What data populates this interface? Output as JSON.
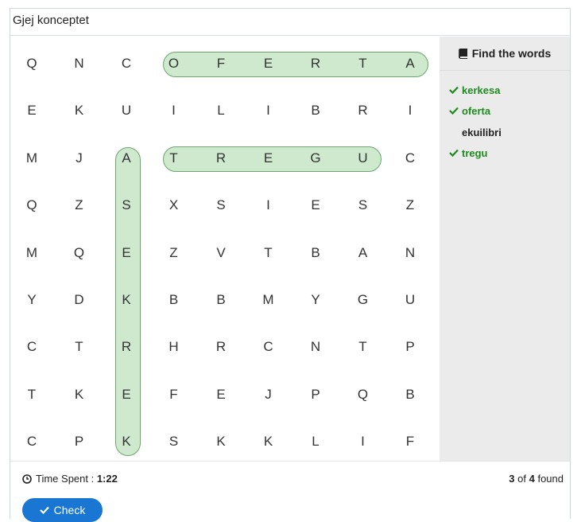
{
  "header": {
    "title": "Gjej konceptet"
  },
  "grid": {
    "rows": [
      [
        "Q",
        "N",
        "C",
        "O",
        "F",
        "E",
        "R",
        "T",
        "A"
      ],
      [
        "E",
        "K",
        "U",
        "I",
        "L",
        "I",
        "B",
        "R",
        "I"
      ],
      [
        "M",
        "J",
        "A",
        "T",
        "R",
        "E",
        "G",
        "U",
        "C"
      ],
      [
        "Q",
        "Z",
        "S",
        "X",
        "S",
        "I",
        "E",
        "S",
        "Z"
      ],
      [
        "M",
        "Q",
        "E",
        "Z",
        "V",
        "T",
        "B",
        "A",
        "N"
      ],
      [
        "Y",
        "D",
        "K",
        "B",
        "B",
        "M",
        "Y",
        "G",
        "U"
      ],
      [
        "C",
        "T",
        "R",
        "H",
        "R",
        "C",
        "N",
        "T",
        "P"
      ],
      [
        "T",
        "K",
        "E",
        "F",
        "E",
        "J",
        "P",
        "Q",
        "B"
      ],
      [
        "C",
        "P",
        "K",
        "S",
        "K",
        "K",
        "L",
        "I",
        "F"
      ]
    ],
    "highlight_color": "#bfe2bf",
    "highlight_border": "#6aa86a"
  },
  "sidebar": {
    "heading": "Find the words",
    "heading_icon": "book-icon",
    "words": [
      {
        "text": "kerkesa",
        "found": true
      },
      {
        "text": "oferta",
        "found": true
      },
      {
        "text": "ekuilibri",
        "found": false
      },
      {
        "text": "tregu",
        "found": true
      }
    ],
    "found_color": "#1e8a1e"
  },
  "footer": {
    "time_label": "Time Spent : ",
    "time_value": "1:22",
    "found_num": "3",
    "found_of": " of ",
    "found_total": "4",
    "found_suffix": " found"
  },
  "check_button": {
    "label": "Check",
    "color": "#1976d2"
  }
}
